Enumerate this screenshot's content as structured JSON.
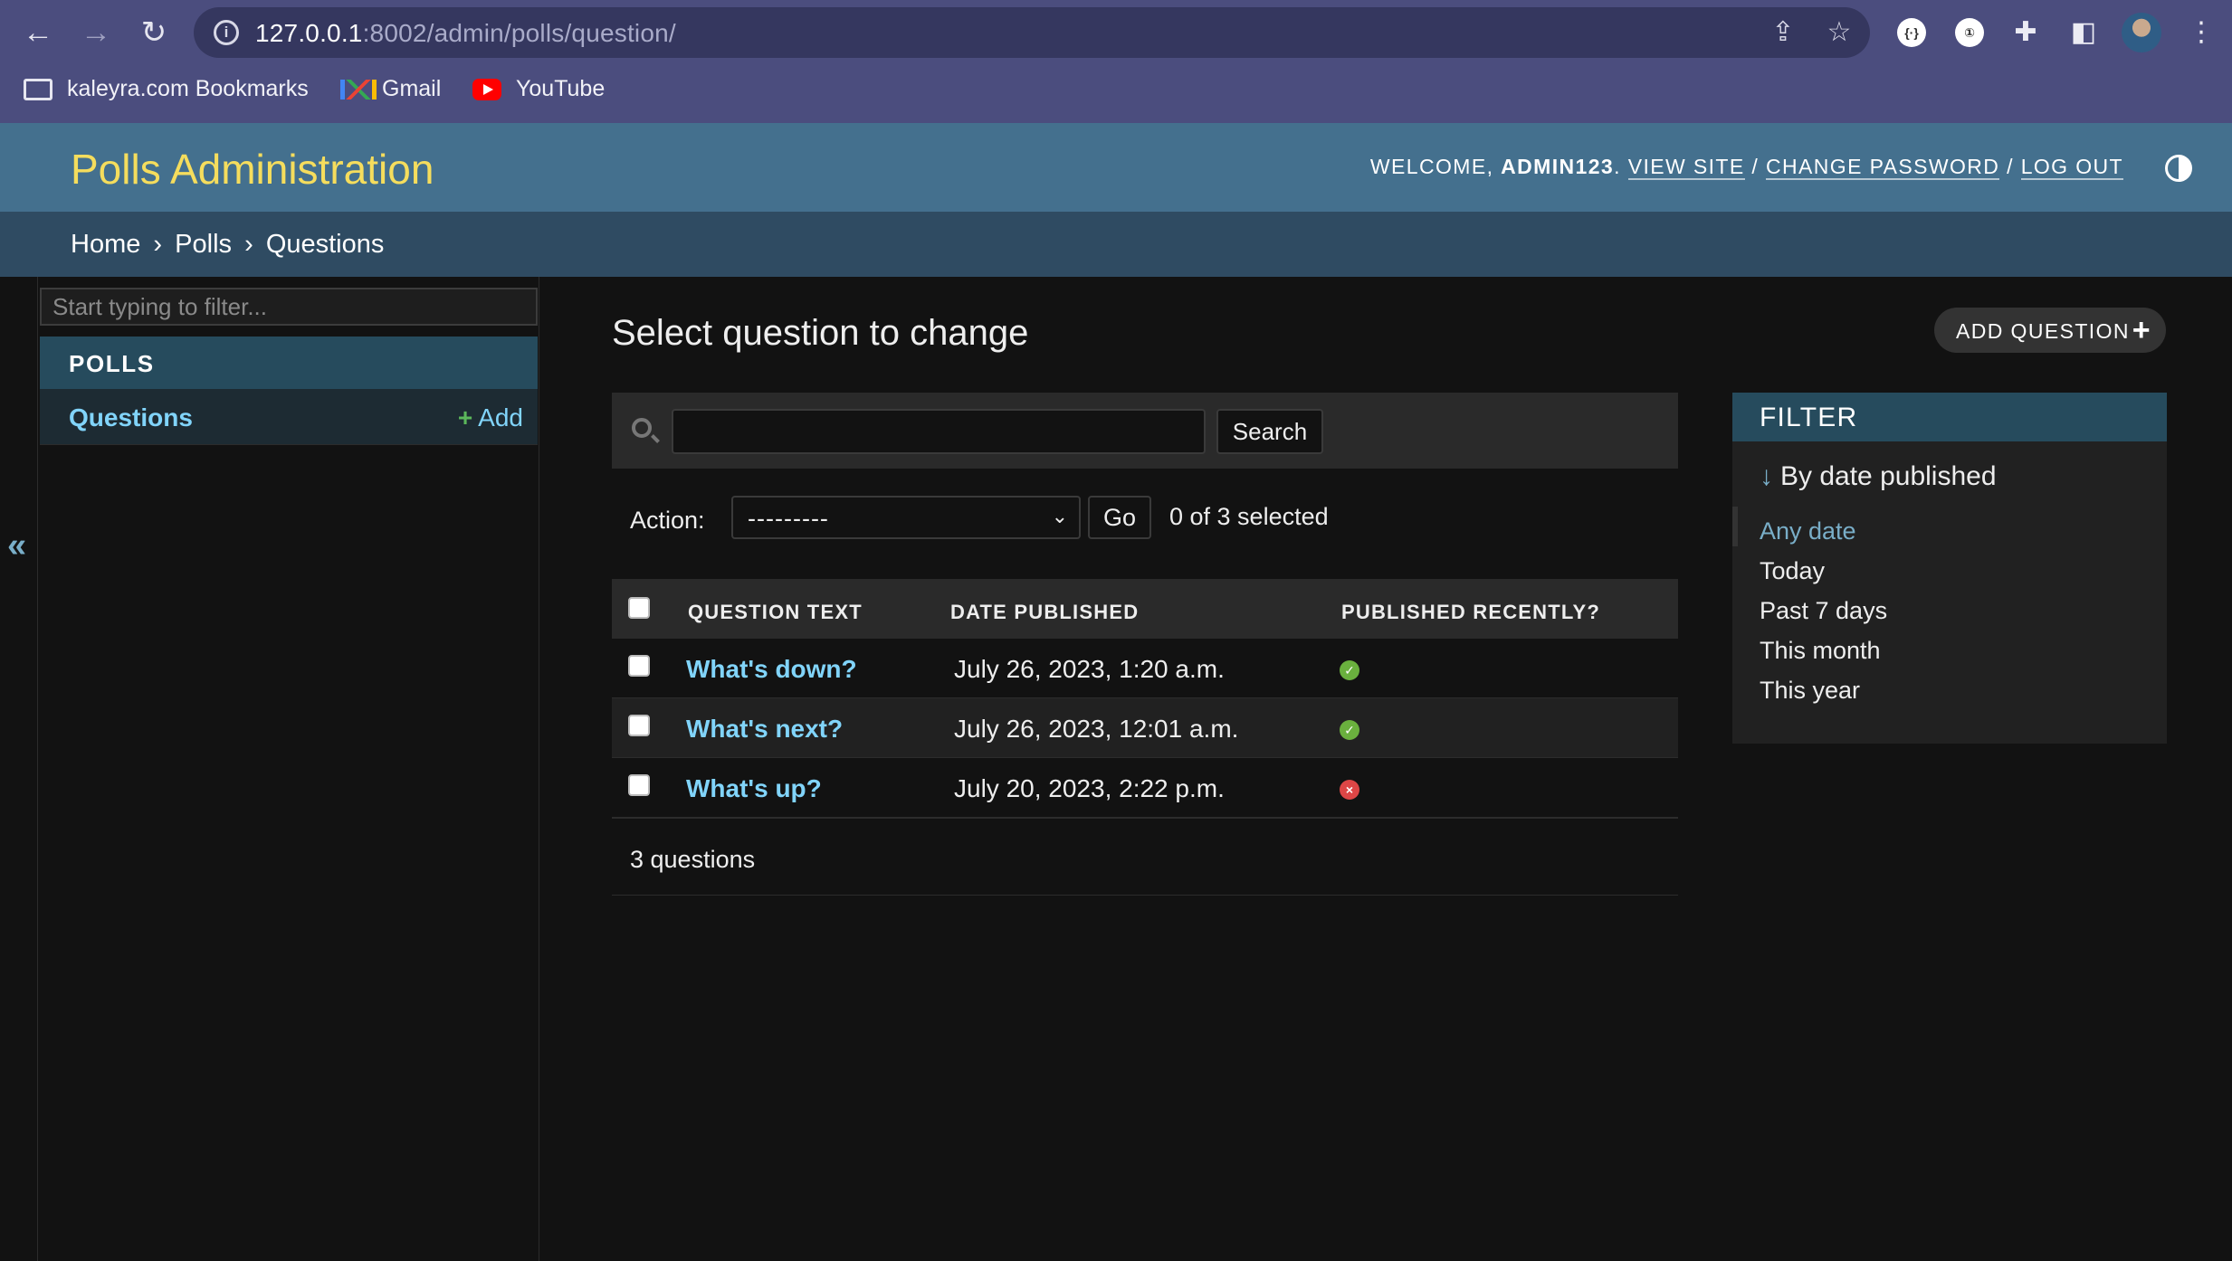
{
  "browser": {
    "url_host": "127.0.0.1",
    "url_rest": ":8002/admin/polls/question/",
    "bookmarks": [
      {
        "label": "kaleyra.com Bookmarks",
        "icon": "folder-icon"
      },
      {
        "label": "Gmail",
        "icon": "gmail-icon"
      },
      {
        "label": "YouTube",
        "icon": "youtube-icon"
      }
    ]
  },
  "header": {
    "site_title": "Polls Administration",
    "welcome": "WELCOME,",
    "username": "ADMIN123",
    "view_site": "VIEW SITE",
    "change_password": "CHANGE PASSWORD",
    "log_out": "LOG OUT",
    "separator": "/"
  },
  "breadcrumbs": {
    "home": "Home",
    "app": "Polls",
    "current": "Questions",
    "sep": "›"
  },
  "sidebar": {
    "filter_placeholder": "Start typing to filter...",
    "app_caption": "POLLS",
    "model": "Questions",
    "add_label": "Add",
    "collapse": "«"
  },
  "main": {
    "title": "Select question to change",
    "add_button": "ADD QUESTION",
    "search_button": "Search",
    "action_label": "Action:",
    "action_value": "---------",
    "go_button": "Go",
    "selection_counter": "0 of 3 selected",
    "columns": [
      "QUESTION TEXT",
      "DATE PUBLISHED",
      "PUBLISHED RECENTLY?"
    ],
    "rows": [
      {
        "question": "What's down?",
        "date": "July 26, 2023, 1:20 a.m.",
        "recent": true
      },
      {
        "question": "What's next?",
        "date": "July 26, 2023, 12:01 a.m.",
        "recent": true
      },
      {
        "question": "What's up?",
        "date": "July 20, 2023, 2:22 p.m.",
        "recent": false
      }
    ],
    "paginator": "3 questions"
  },
  "filter": {
    "title": "FILTER",
    "section": "By date published",
    "options": [
      "Any date",
      "Today",
      "Past 7 days",
      "This month",
      "This year"
    ],
    "selected": "Any date"
  },
  "colors": {
    "header_bg": "#44708e",
    "breadcrumb_bg": "#2f4b62",
    "accent_link": "#81d4fa",
    "brand_yellow": "#f5dd5d",
    "status_yes": "#6ab03e",
    "status_no": "#dd4646"
  }
}
